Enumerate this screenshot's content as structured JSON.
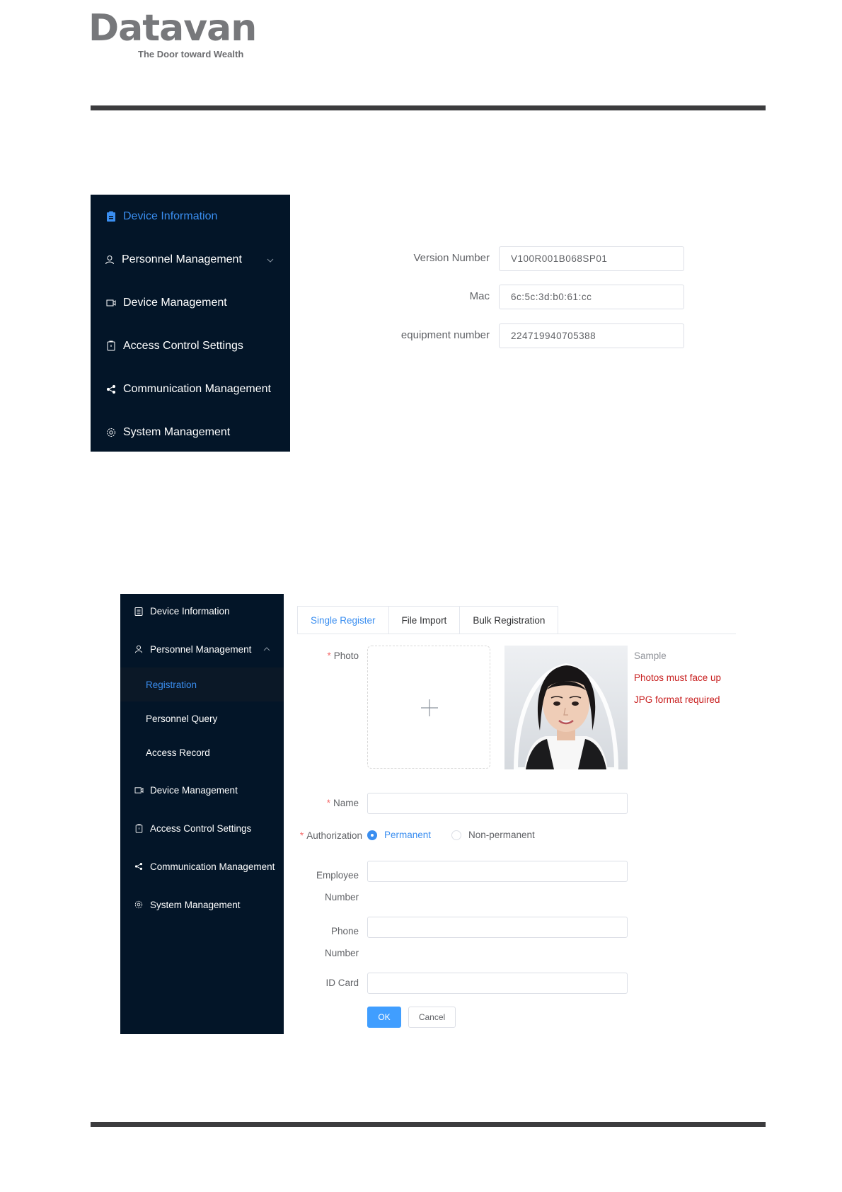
{
  "brand": {
    "logo": "Datavan",
    "tagline": "The Door toward Wealth"
  },
  "device_info_screen": {
    "sidebar": {
      "items": [
        {
          "label": "Device Information",
          "icon": "clipboard-icon",
          "active": true
        },
        {
          "label": "Personnel Management",
          "icon": "user-icon",
          "expandable": true
        },
        {
          "label": "Device Management",
          "icon": "camera-icon"
        },
        {
          "label": "Access Control Settings",
          "icon": "lock-icon"
        },
        {
          "label": "Communication Management",
          "icon": "share-icon"
        },
        {
          "label": "System Management",
          "icon": "gear-icon"
        }
      ]
    },
    "fields": {
      "version_label": "Version Number",
      "version_value": "V100R001B068SP01",
      "mac_label": "Mac",
      "mac_value": "6c:5c:3d:b0:61:cc",
      "equipment_label": "equipment number",
      "equipment_value": "224719940705388"
    }
  },
  "registration_screen": {
    "sidebar": {
      "device_information": "Device Information",
      "personnel_management": "Personnel Management",
      "registration": "Registration",
      "personnel_query": "Personnel Query",
      "access_record": "Access Record",
      "device_management": "Device Management",
      "access_control_settings": "Access Control Settings",
      "communication_management": "Communication Management",
      "system_management": "System Management"
    },
    "tabs": {
      "single_register": "Single Register",
      "file_import": "File Import",
      "bulk_registration": "Bulk Registration"
    },
    "form": {
      "photo_label": "Photo",
      "sample_title": "Sample",
      "sample_note_1": "Photos must face up",
      "sample_note_2": "JPG format required",
      "name_label": "Name",
      "authorization_label": "Authorization",
      "permanent": "Permanent",
      "non_permanent": "Non-permanent",
      "employee_label_1": "Employee",
      "employee_label_2": "Number",
      "phone_label_1": "Phone",
      "phone_label_2": "Number",
      "id_card_label": "ID Card",
      "ok_button": "OK",
      "cancel_button": "Cancel"
    },
    "required_mark": "*"
  },
  "colors": {
    "sidebar_bg": "#031528",
    "accent": "#3a8ef0",
    "warning_text": "#c81e1e"
  }
}
